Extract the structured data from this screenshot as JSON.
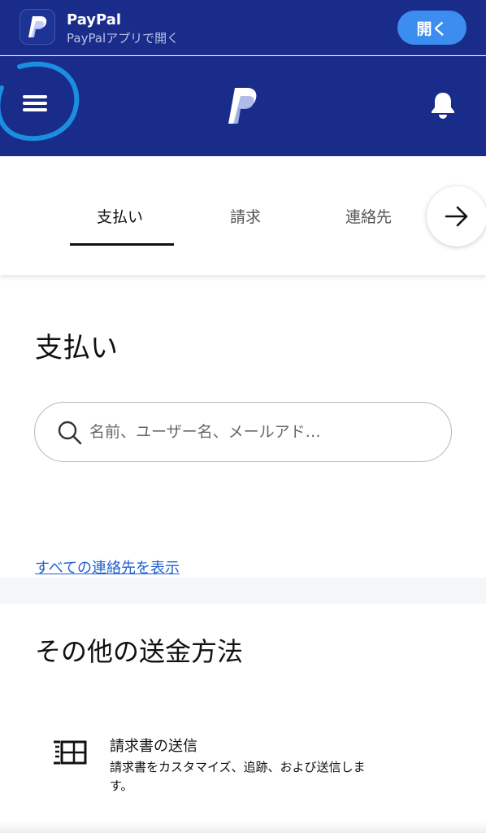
{
  "app_banner": {
    "app_name": "PayPal",
    "subtitle": "PayPalアプリで開く",
    "open_button": "開く"
  },
  "header": {
    "menu_icon": "hamburger-menu-icon",
    "logo_icon": "paypal-logo-icon",
    "notification_icon": "bell-icon"
  },
  "tabs": [
    {
      "label": "支払い",
      "active": true
    },
    {
      "label": "請求",
      "active": false
    },
    {
      "label": "連絡先",
      "active": false
    }
  ],
  "payments": {
    "title": "支払い",
    "search_placeholder": "名前、ユーザー名、メールアド…",
    "contacts_link": "すべての連絡先を表示"
  },
  "other_methods": {
    "title": "その他の送金方法",
    "items": [
      {
        "icon": "invoice-icon",
        "title": "請求書の送信",
        "description": "請求書をカスタマイズ、追跡、および送信します。"
      }
    ]
  },
  "colors": {
    "brand_dark": "#1a2c8a",
    "accent_button": "#3b8ef0",
    "link": "#1f5fd0",
    "annotation_circle": "#1a8fe0"
  }
}
